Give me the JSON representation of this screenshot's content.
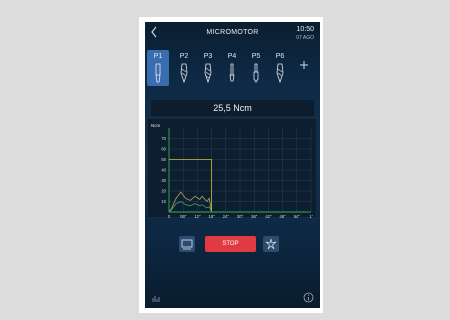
{
  "header": {
    "title": "MICROMOTOR",
    "time": "10:50",
    "date": "07 AGO"
  },
  "programs": [
    {
      "label": "P1",
      "active": true
    },
    {
      "label": "P2",
      "active": false
    },
    {
      "label": "P3",
      "active": false
    },
    {
      "label": "P4",
      "active": false
    },
    {
      "label": "P5",
      "active": false
    },
    {
      "label": "P6",
      "active": false
    }
  ],
  "torque": {
    "value": "25,5 Ncm"
  },
  "chart_data": {
    "type": "line",
    "ylabel": "Ncm",
    "y_ticks": [
      "70",
      "60",
      "50",
      "40",
      "30",
      "20",
      "10"
    ],
    "x_ticks": [
      "0",
      "06\"",
      "12\"",
      "18\"",
      "24\"",
      "30\"",
      "36\"",
      "42\"",
      "48\"",
      "54\"",
      "1'"
    ],
    "ylim": [
      0,
      80
    ],
    "threshold": {
      "value": 50,
      "x_end": "18\"",
      "color": "#c9c22a"
    },
    "series": [
      {
        "color": "#b8a06a",
        "values": [
          [
            0,
            0
          ],
          [
            1,
            3
          ],
          [
            3,
            13
          ],
          [
            5,
            19
          ],
          [
            7,
            13
          ],
          [
            9,
            11
          ],
          [
            11,
            15
          ],
          [
            13,
            12
          ],
          [
            14,
            15
          ],
          [
            16,
            10
          ],
          [
            17,
            13
          ],
          [
            18,
            0
          ]
        ]
      },
      {
        "color": "#4c9a6a",
        "values": [
          [
            0,
            0
          ],
          [
            1,
            2
          ],
          [
            3,
            8
          ],
          [
            5,
            10
          ],
          [
            7,
            7
          ],
          [
            9,
            6
          ],
          [
            11,
            8
          ],
          [
            13,
            6
          ],
          [
            14,
            7
          ],
          [
            16,
            4
          ],
          [
            17,
            5
          ],
          [
            18,
            0
          ]
        ]
      }
    ],
    "grid": true,
    "colors": {
      "axis": "#2fb14a",
      "grid": "#2a3f55"
    }
  },
  "controls": {
    "stop_label": "STOP"
  },
  "icons": {
    "back": "chevron-left-icon",
    "add": "plus-icon",
    "display": "monitor-icon",
    "turbo": "rotor-icon",
    "stats": "bar-chart-icon",
    "info": "info-icon"
  }
}
